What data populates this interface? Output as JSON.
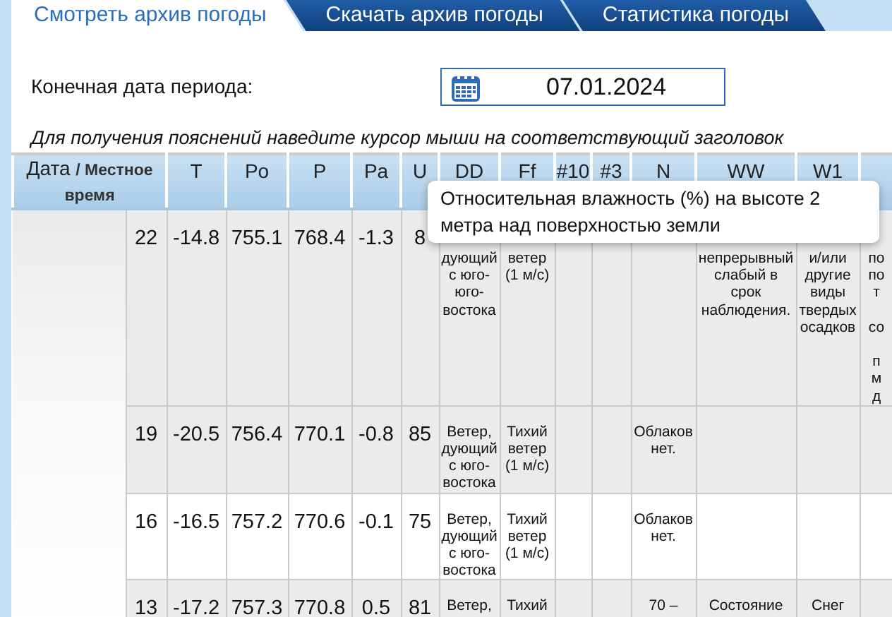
{
  "tabs": [
    {
      "label": "Смотреть архив погоды",
      "selected": true
    },
    {
      "label": "Скачать архив погоды",
      "selected": false
    },
    {
      "label": "Статистика погоды",
      "selected": false
    }
  ],
  "date_filter": {
    "label": "Конечная дата периода:",
    "value": "07.01.2024"
  },
  "hint": "Для получения пояснений наведите курсор мыши на соответствующий заголовок",
  "table": {
    "columns": [
      {
        "label": "Дата",
        "sublabel": "/ Местное время",
        "colspan": 2
      },
      {
        "label": "T"
      },
      {
        "label": "Po"
      },
      {
        "label": "P"
      },
      {
        "label": "Pa"
      },
      {
        "label": "U"
      },
      {
        "label": "DD"
      },
      {
        "label": "Ff"
      },
      {
        "label": "#10"
      },
      {
        "label": "#3"
      },
      {
        "label": "N"
      },
      {
        "label": "WW"
      },
      {
        "label": "W1"
      },
      {}
    ],
    "rows": [
      {
        "cells": [
          "",
          "22",
          "-14.8",
          "755.1",
          "768.4",
          "-1.3",
          "8",
          "дующий\nс юго-\nюго-\nвостока",
          "ветер\n(1 м/с)",
          null,
          null,
          null,
          "непрерывный\nслабый в\nсрок\nнаблюдения.",
          "и/или\nдругие\nвиды\nтвердых\nосадков",
          "по\nпо\nт\n\nсо\n\nп\nм\nд"
        ]
      },
      {
        "cells": [
          "",
          "19",
          "-20.5",
          "756.4",
          "770.1",
          "-0.8",
          "85",
          "Ветер,\nдующий\nс юго-\nвостока",
          "Тихий\nветер\n(1 м/с)",
          null,
          null,
          "Облаков\nнет.",
          null,
          null,
          null
        ]
      },
      {
        "cells": [
          "",
          "16",
          "-16.5",
          "757.2",
          "770.6",
          "-0.1",
          "75",
          "Ветер,\nдующий\nс юго-\nвостока",
          "Тихий\nветер\n(1 м/с)",
          null,
          null,
          "Облаков\nнет.",
          null,
          null,
          null
        ]
      },
      {
        "cells": [
          "",
          "13",
          "-17.2",
          "757.3",
          "770.8",
          "0.5",
          "81",
          "Ветер,",
          "Тихий",
          null,
          null,
          "70 –",
          "Состояние",
          "Снег",
          null
        ]
      }
    ]
  },
  "tooltip": {
    "text": "Относительная влажность (%) на высоте 2 метра над поверхностью земли"
  }
}
